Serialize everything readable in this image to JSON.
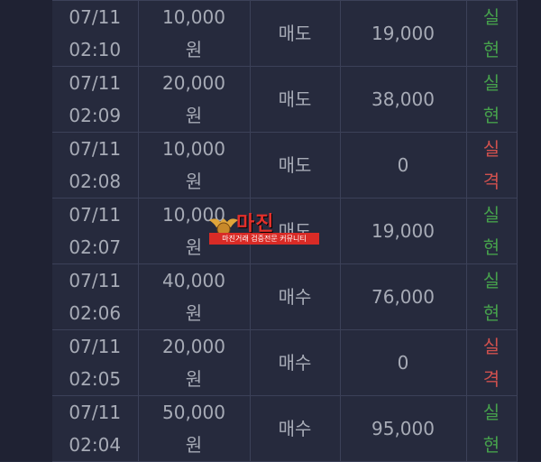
{
  "rows": [
    {
      "date": "07/11",
      "time": "02:10",
      "amount": "10,000",
      "unit": "원",
      "type": "매도",
      "profit": "19,000",
      "result": [
        "실",
        "현"
      ],
      "result_status": "win"
    },
    {
      "date": "07/11",
      "time": "02:09",
      "amount": "20,000",
      "unit": "원",
      "type": "매도",
      "profit": "38,000",
      "result": [
        "실",
        "현"
      ],
      "result_status": "win"
    },
    {
      "date": "07/11",
      "time": "02:08",
      "amount": "10,000",
      "unit": "원",
      "type": "매도",
      "profit": "0",
      "result": [
        "실",
        "격"
      ],
      "result_status": "lose"
    },
    {
      "date": "07/11",
      "time": "02:07",
      "amount": "10,000",
      "unit": "원",
      "type": "매도",
      "profit": "19,000",
      "result": [
        "실",
        "현"
      ],
      "result_status": "win"
    },
    {
      "date": "07/11",
      "time": "02:06",
      "amount": "40,000",
      "unit": "원",
      "type": "매수",
      "profit": "76,000",
      "result": [
        "실",
        "현"
      ],
      "result_status": "win"
    },
    {
      "date": "07/11",
      "time": "02:05",
      "amount": "20,000",
      "unit": "원",
      "type": "매수",
      "profit": "0",
      "result": [
        "실",
        "격"
      ],
      "result_status": "lose"
    },
    {
      "date": "07/11",
      "time": "02:04",
      "amount": "50,000",
      "unit": "원",
      "type": "매수",
      "profit": "95,000",
      "result": [
        "실",
        "현"
      ],
      "result_status": "win"
    }
  ],
  "watermark": {
    "title": "마진",
    "subtitle": "마진거래 검증전문 커뮤니티"
  },
  "colors": {
    "win": "#46a04c",
    "lose": "#d0514e",
    "text": "#a7abb6",
    "background": "#262a3d"
  }
}
